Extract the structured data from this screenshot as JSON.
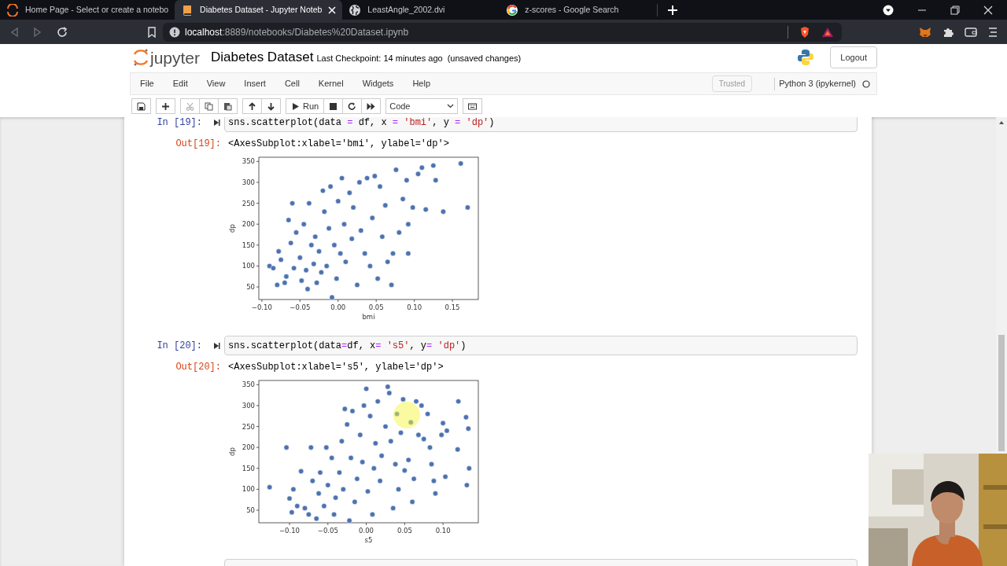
{
  "browser": {
    "tabs": [
      {
        "title": "Home Page - Select or create a notebo",
        "selected": false
      },
      {
        "title": "Diabetes Dataset - Jupyter Noteb",
        "selected": true
      },
      {
        "title": "LeastAngle_2002.dvi",
        "selected": false
      },
      {
        "title": "z-scores - Google Search",
        "selected": false
      }
    ],
    "url_host": "localhost",
    "url_path": ":8889/notebooks/Diabetes%20Dataset.ipynb"
  },
  "jupyter": {
    "logo_text": "jupyter",
    "notebook_title": "Diabetes Dataset",
    "checkpoint": "Last Checkpoint: 14 minutes ago",
    "save_status": "(unsaved changes)",
    "logout": "Logout",
    "menu": [
      "File",
      "Edit",
      "View",
      "Insert",
      "Cell",
      "Kernel",
      "Widgets",
      "Help"
    ],
    "trusted": "Trusted",
    "kernel": "Python 3 (ipykernel)",
    "run_label": "Run",
    "cell_type": "Code"
  },
  "cells": [
    {
      "kind": "input",
      "prompt": "In [19]:",
      "code": "sns.scatterplot(data = df, x = 'bmi', y = 'dp')"
    },
    {
      "kind": "output",
      "prompt": "Out[19]:",
      "text": "<AxesSubplot:xlabel='bmi', ylabel='dp'>",
      "chart_data": {
        "type": "scatter",
        "xlabel": "bmi",
        "ylabel": "dp",
        "xlim": [
          -0.104,
          0.184
        ],
        "ylim": [
          20,
          360
        ],
        "xticks": [
          {
            "value": -0.1,
            "label": "−0.10"
          },
          {
            "value": -0.05,
            "label": "−0.05"
          },
          {
            "value": 0,
            "label": "0.00"
          },
          {
            "value": 0.05,
            "label": "0.05"
          },
          {
            "value": 0.1,
            "label": "0.10"
          },
          {
            "value": 0.15,
            "label": "0.15"
          }
        ],
        "yticks": [
          50,
          100,
          150,
          200,
          250,
          300,
          350
        ],
        "x": [
          -0.09,
          -0.085,
          -0.08,
          -0.078,
          -0.075,
          -0.07,
          -0.068,
          -0.065,
          -0.062,
          -0.06,
          -0.058,
          -0.055,
          -0.05,
          -0.048,
          -0.045,
          -0.042,
          -0.04,
          -0.038,
          -0.035,
          -0.032,
          -0.03,
          -0.028,
          -0.025,
          -0.022,
          -0.02,
          -0.018,
          -0.015,
          -0.012,
          -0.01,
          -0.008,
          -0.005,
          -0.002,
          0,
          0.003,
          0.005,
          0.008,
          0.01,
          0.015,
          0.018,
          0.02,
          0.025,
          0.028,
          0.03,
          0.035,
          0.038,
          0.042,
          0.045,
          0.048,
          0.052,
          0.055,
          0.058,
          0.062,
          0.065,
          0.07,
          0.072,
          0.076,
          0.08,
          0.085,
          0.09,
          0.092,
          0.092,
          0.098,
          0.105,
          0.11,
          0.115,
          0.125,
          0.128,
          0.138,
          0.161,
          0.17
        ],
        "series": [
          {
            "color": "#4c72b0",
            "values": [
              100,
              95,
              55,
              135,
              115,
              60,
              75,
              210,
              155,
              250,
              95,
              180,
              120,
              65,
              200,
              90,
              45,
              250,
              150,
              105,
              170,
              60,
              135,
              85,
              280,
              230,
              100,
              190,
              290,
              25,
              150,
              70,
              255,
              130,
              310,
              200,
              110,
              275,
              165,
              240,
              55,
              300,
              185,
              130,
              310,
              100,
              215,
              315,
              70,
              290,
              170,
              245,
              110,
              55,
              130,
              330,
              180,
              260,
              305,
              200,
              130,
              240,
              320,
              335,
              235,
              340,
              305,
              230,
              345,
              240
            ]
          }
        ]
      }
    },
    {
      "kind": "input",
      "prompt": "In [20]:",
      "code": "sns.scatterplot(data=df, x= 's5', y= 'dp')"
    },
    {
      "kind": "output",
      "prompt": "Out[20]:",
      "text": "<AxesSubplot:xlabel='s5', ylabel='dp'>",
      "chart_data": {
        "type": "scatter",
        "xlabel": "s5",
        "ylabel": "dp",
        "xlim": [
          -0.14,
          0.146
        ],
        "ylim": [
          20,
          360
        ],
        "xticks": [
          {
            "value": -0.1,
            "label": "−0.10"
          },
          {
            "value": -0.05,
            "label": "−0.05"
          },
          {
            "value": 0,
            "label": "0.00"
          },
          {
            "value": 0.05,
            "label": "0.05"
          },
          {
            "value": 0.1,
            "label": "0.10"
          }
        ],
        "yticks": [
          50,
          100,
          150,
          200,
          250,
          300,
          350
        ],
        "x": [
          -0.126,
          -0.104,
          -0.1,
          -0.097,
          -0.095,
          -0.09,
          -0.085,
          -0.08,
          -0.075,
          -0.072,
          -0.07,
          -0.065,
          -0.062,
          -0.06,
          -0.055,
          -0.052,
          -0.05,
          -0.045,
          -0.042,
          -0.04,
          -0.035,
          -0.032,
          -0.03,
          -0.028,
          -0.025,
          -0.022,
          -0.02,
          -0.018,
          -0.015,
          -0.012,
          -0.008,
          -0.005,
          -0.003,
          0,
          0.002,
          0.005,
          0.008,
          0.01,
          0.012,
          0.015,
          0.018,
          0.02,
          0.025,
          0.028,
          0.03,
          0.032,
          0.035,
          0.038,
          0.04,
          0.042,
          0.045,
          0.048,
          0.05,
          0.055,
          0.058,
          0.06,
          0.062,
          0.065,
          0.068,
          0.072,
          0.075,
          0.08,
          0.083,
          0.085,
          0.088,
          0.09,
          0.098,
          0.1,
          0.103,
          0.105,
          0.119,
          0.12,
          0.13,
          0.131,
          0.133,
          0.134
        ],
        "series": [
          {
            "color": "#4c72b0",
            "values": [
              105,
              200,
              78,
              45,
              100,
              60,
              143,
              55,
              40,
              200,
              120,
              30,
              90,
              140,
              60,
              200,
              110,
              175,
              40,
              80,
              140,
              215,
              100,
              292,
              255,
              25,
              175,
              287,
              70,
              125,
              230,
              165,
              300,
              340,
              95,
              275,
              40,
              150,
              210,
              310,
              120,
              180,
              250,
              345,
              330,
              215,
              55,
              160,
              280,
              100,
              235,
              315,
              145,
              170,
              260,
              70,
              125,
              310,
              230,
              300,
              220,
              280,
              200,
              160,
              120,
              90,
              230,
              258,
              130,
              240,
              195,
              310,
              272,
              110,
              245,
              150
            ]
          }
        ]
      }
    },
    {
      "kind": "input"
    }
  ]
}
